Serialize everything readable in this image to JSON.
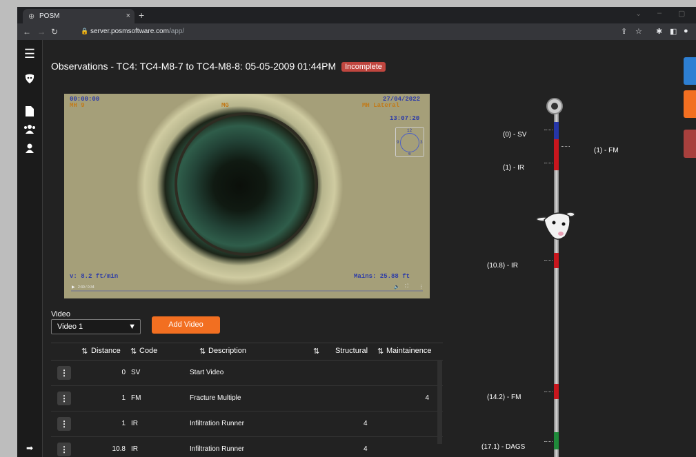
{
  "browser": {
    "tab_title": "POSM",
    "new_tab": "+",
    "close_tab": "×",
    "url_host": "server.posmsoftware.com",
    "url_path": "/app/"
  },
  "page": {
    "title": "Observations - TC4: TC4-M8-7 to TC4-M8-8: 05-05-2009 01:44PM",
    "status_badge": "Incomplete"
  },
  "video_overlay": {
    "timecode": "00:00:00",
    "manhole": "MH 9",
    "date": "27/04/2022",
    "time": "13:07:20",
    "lateral": "MH Lateral",
    "center_tag": "MG",
    "speed": "v:   8.2 ft/min",
    "distance": "Mains:   25.88 ft",
    "clock_12": "12",
    "clock_3": "3",
    "clock_6": "6",
    "clock_9": "9",
    "player_time": "2:30 / 0:34"
  },
  "video_select": {
    "label": "Video",
    "value": "Video 1",
    "add_button": "Add Video"
  },
  "table": {
    "headers": {
      "distance": "Distance",
      "code": "Code",
      "description": "Description",
      "structural": "Structural",
      "maintenance": "Maintainence"
    },
    "rows": [
      {
        "distance": "0",
        "code": "SV",
        "description": "Start Video",
        "structural": "",
        "maintenance": ""
      },
      {
        "distance": "1",
        "code": "FM",
        "description": "Fracture Multiple",
        "structural": "",
        "maintenance": "4"
      },
      {
        "distance": "1",
        "code": "IR",
        "description": "Infiltration Runner",
        "structural": "4",
        "maintenance": ""
      },
      {
        "distance": "10.8",
        "code": "IR",
        "description": "Infiltration Runner",
        "structural": "4",
        "maintenance": ""
      }
    ]
  },
  "pipe_labels": {
    "l0": "(0) - SV",
    "l1": "(1) - FM",
    "l2": "(1) - IR",
    "l3": "(10.8) - IR",
    "l4": "(14.2) - FM",
    "l5": "(17.1) - DAGS"
  },
  "colors": {
    "accent_orange": "#f26f21",
    "badge_red": "#c0463f",
    "defect_blue": "#2636a8",
    "defect_red": "#c8161d",
    "defect_green": "#1f8a3a"
  }
}
